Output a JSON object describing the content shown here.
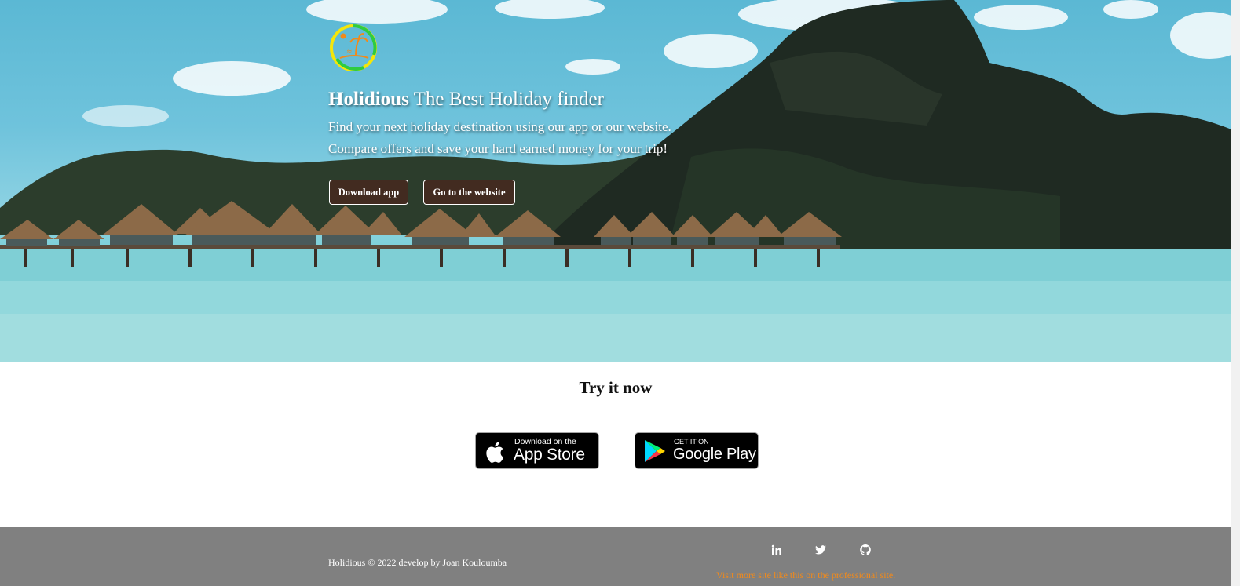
{
  "hero": {
    "brand": "Holidious",
    "tagline": " The Best Holiday finder",
    "description_line1": "Find your next holiday destination using our app or our website.",
    "description_line2": "Compare offers and save your hard earned money for your trip!",
    "download_button": "Download app",
    "website_button": "Go to the website"
  },
  "try_section": {
    "title": "Try it now",
    "app_store": {
      "small_text": "Download on the",
      "big_text": "App Store"
    },
    "google_play": {
      "small_text": "GET IT ON",
      "big_text": "Google Play"
    }
  },
  "footer": {
    "copyright": "Holidious © 2022 develop by Joan Kouloumba",
    "social_icons": [
      "linkedin-icon",
      "twitter-icon",
      "github-icon"
    ],
    "pro_link": "Visit more site like this on the professional site."
  },
  "colors": {
    "button_bg": "#46281e",
    "footer_bg": "#808080",
    "link_orange": "#f28a1a",
    "logo_ring_green": "#2ecc40",
    "logo_ring_yellow": "#f5e60a"
  }
}
